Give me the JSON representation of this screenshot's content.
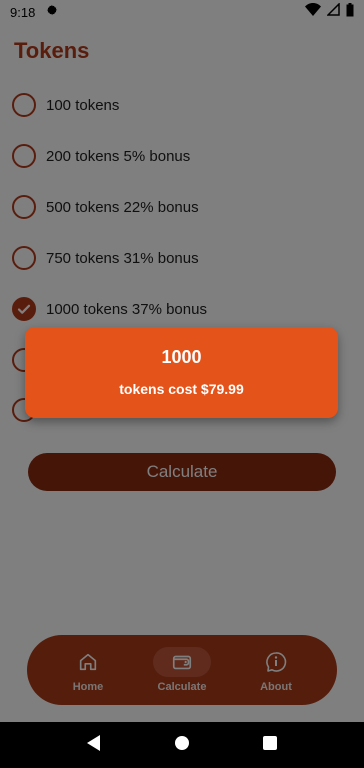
{
  "status_bar": {
    "time": "9:18"
  },
  "page": {
    "title": "Tokens"
  },
  "options": [
    {
      "label": "100 tokens",
      "checked": false
    },
    {
      "label": "200 tokens 5% bonus",
      "checked": false
    },
    {
      "label": "500 tokens 22% bonus",
      "checked": false
    },
    {
      "label": "750 tokens 31% bonus",
      "checked": false
    },
    {
      "label": "1000 tokens 37% bonus",
      "checked": true
    },
    {
      "label": "",
      "checked": false
    },
    {
      "label": "",
      "checked": false
    }
  ],
  "calculate_button": {
    "label": "Calculate"
  },
  "result": {
    "count": "1000",
    "cost_text": "tokens cost $79.99"
  },
  "bottom_nav": {
    "items": [
      {
        "label": "Home",
        "icon": "home-icon",
        "active": false
      },
      {
        "label": "Calculate",
        "icon": "wallet-icon",
        "active": true
      },
      {
        "label": "About",
        "icon": "info-icon",
        "active": false
      }
    ]
  },
  "colors": {
    "accent": "#b33a1a",
    "toast": "#e4531a"
  }
}
